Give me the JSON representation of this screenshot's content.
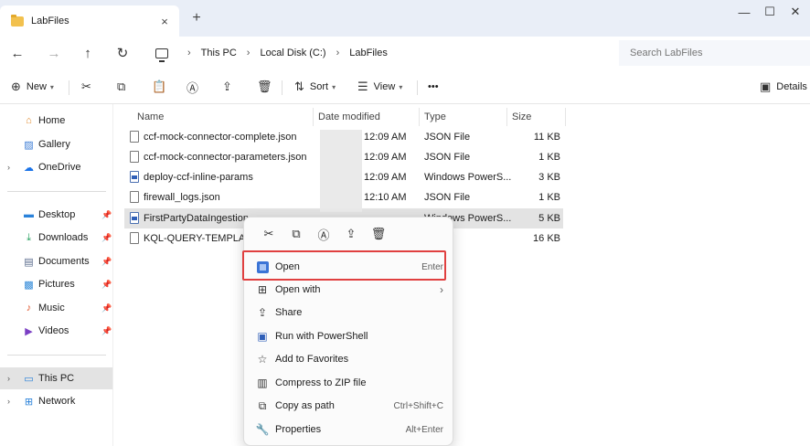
{
  "tab": {
    "title": "LabFiles",
    "close": "×",
    "new_tab": "+"
  },
  "window_controls": {
    "minimize": "—",
    "maximize": "☐",
    "close": "✕"
  },
  "nav": {
    "back": "←",
    "forward": "→",
    "up": "↑",
    "refresh": "↻"
  },
  "breadcrumb": [
    "This PC",
    "Local Disk (C:)",
    "LabFiles"
  ],
  "breadcrumb_sep": "›",
  "search": {
    "placeholder": "Search LabFiles"
  },
  "commandbar": {
    "new_label": "New",
    "sort_label": "Sort",
    "view_label": "View",
    "more": "•••",
    "details_label": "Details"
  },
  "sidebar": {
    "items": [
      {
        "label": "Home",
        "icon": "home-icon"
      },
      {
        "label": "Gallery",
        "icon": "gallery-icon"
      },
      {
        "label": "OneDrive",
        "icon": "cloud-icon"
      },
      {
        "label": "Desktop",
        "icon": "desktop-icon"
      },
      {
        "label": "Downloads",
        "icon": "download-icon"
      },
      {
        "label": "Documents",
        "icon": "documents-icon"
      },
      {
        "label": "Pictures",
        "icon": "pictures-icon"
      },
      {
        "label": "Music",
        "icon": "music-icon"
      },
      {
        "label": "Videos",
        "icon": "videos-icon"
      },
      {
        "label": "This PC",
        "icon": "pc-icon"
      },
      {
        "label": "Network",
        "icon": "network-icon"
      }
    ]
  },
  "columns": {
    "name": "Name",
    "date": "Date modified",
    "type": "Type",
    "size": "Size"
  },
  "files": [
    {
      "name": "ccf-mock-connector-complete.json",
      "date": "12:09 AM",
      "type": "JSON File",
      "size": "11 KB"
    },
    {
      "name": "ccf-mock-connector-parameters.json",
      "date": "12:09 AM",
      "type": "JSON File",
      "size": "1 KB"
    },
    {
      "name": "deploy-ccf-inline-params",
      "date": "12:09 AM",
      "type": "Windows PowerS...",
      "size": "3 KB"
    },
    {
      "name": "firewall_logs.json",
      "date": "12:10 AM",
      "type": "JSON File",
      "size": "1 KB"
    },
    {
      "name": "FirstPartyDataIngestion",
      "date": "",
      "type": "Windows PowerS...",
      "size": "5 KB"
    },
    {
      "name": "KQL-QUERY-TEMPLATES.k",
      "date": "",
      "type": "",
      "size": "16 KB"
    }
  ],
  "context_menu": {
    "items": [
      {
        "label": "Open",
        "shortcut": "Enter"
      },
      {
        "label": "Open with",
        "shortcut": "›"
      },
      {
        "label": "Share",
        "shortcut": ""
      },
      {
        "label": "Run with PowerShell",
        "shortcut": ""
      },
      {
        "label": "Add to Favorites",
        "shortcut": ""
      },
      {
        "label": "Compress to ZIP file",
        "shortcut": ""
      },
      {
        "label": "Copy as path",
        "shortcut": "Ctrl+Shift+C"
      },
      {
        "label": "Properties",
        "shortcut": "Alt+Enter"
      }
    ]
  },
  "colors": {
    "accent": "#3b74d6",
    "highlight_box": "#e04040",
    "selected_row": "#e3e3e3"
  }
}
